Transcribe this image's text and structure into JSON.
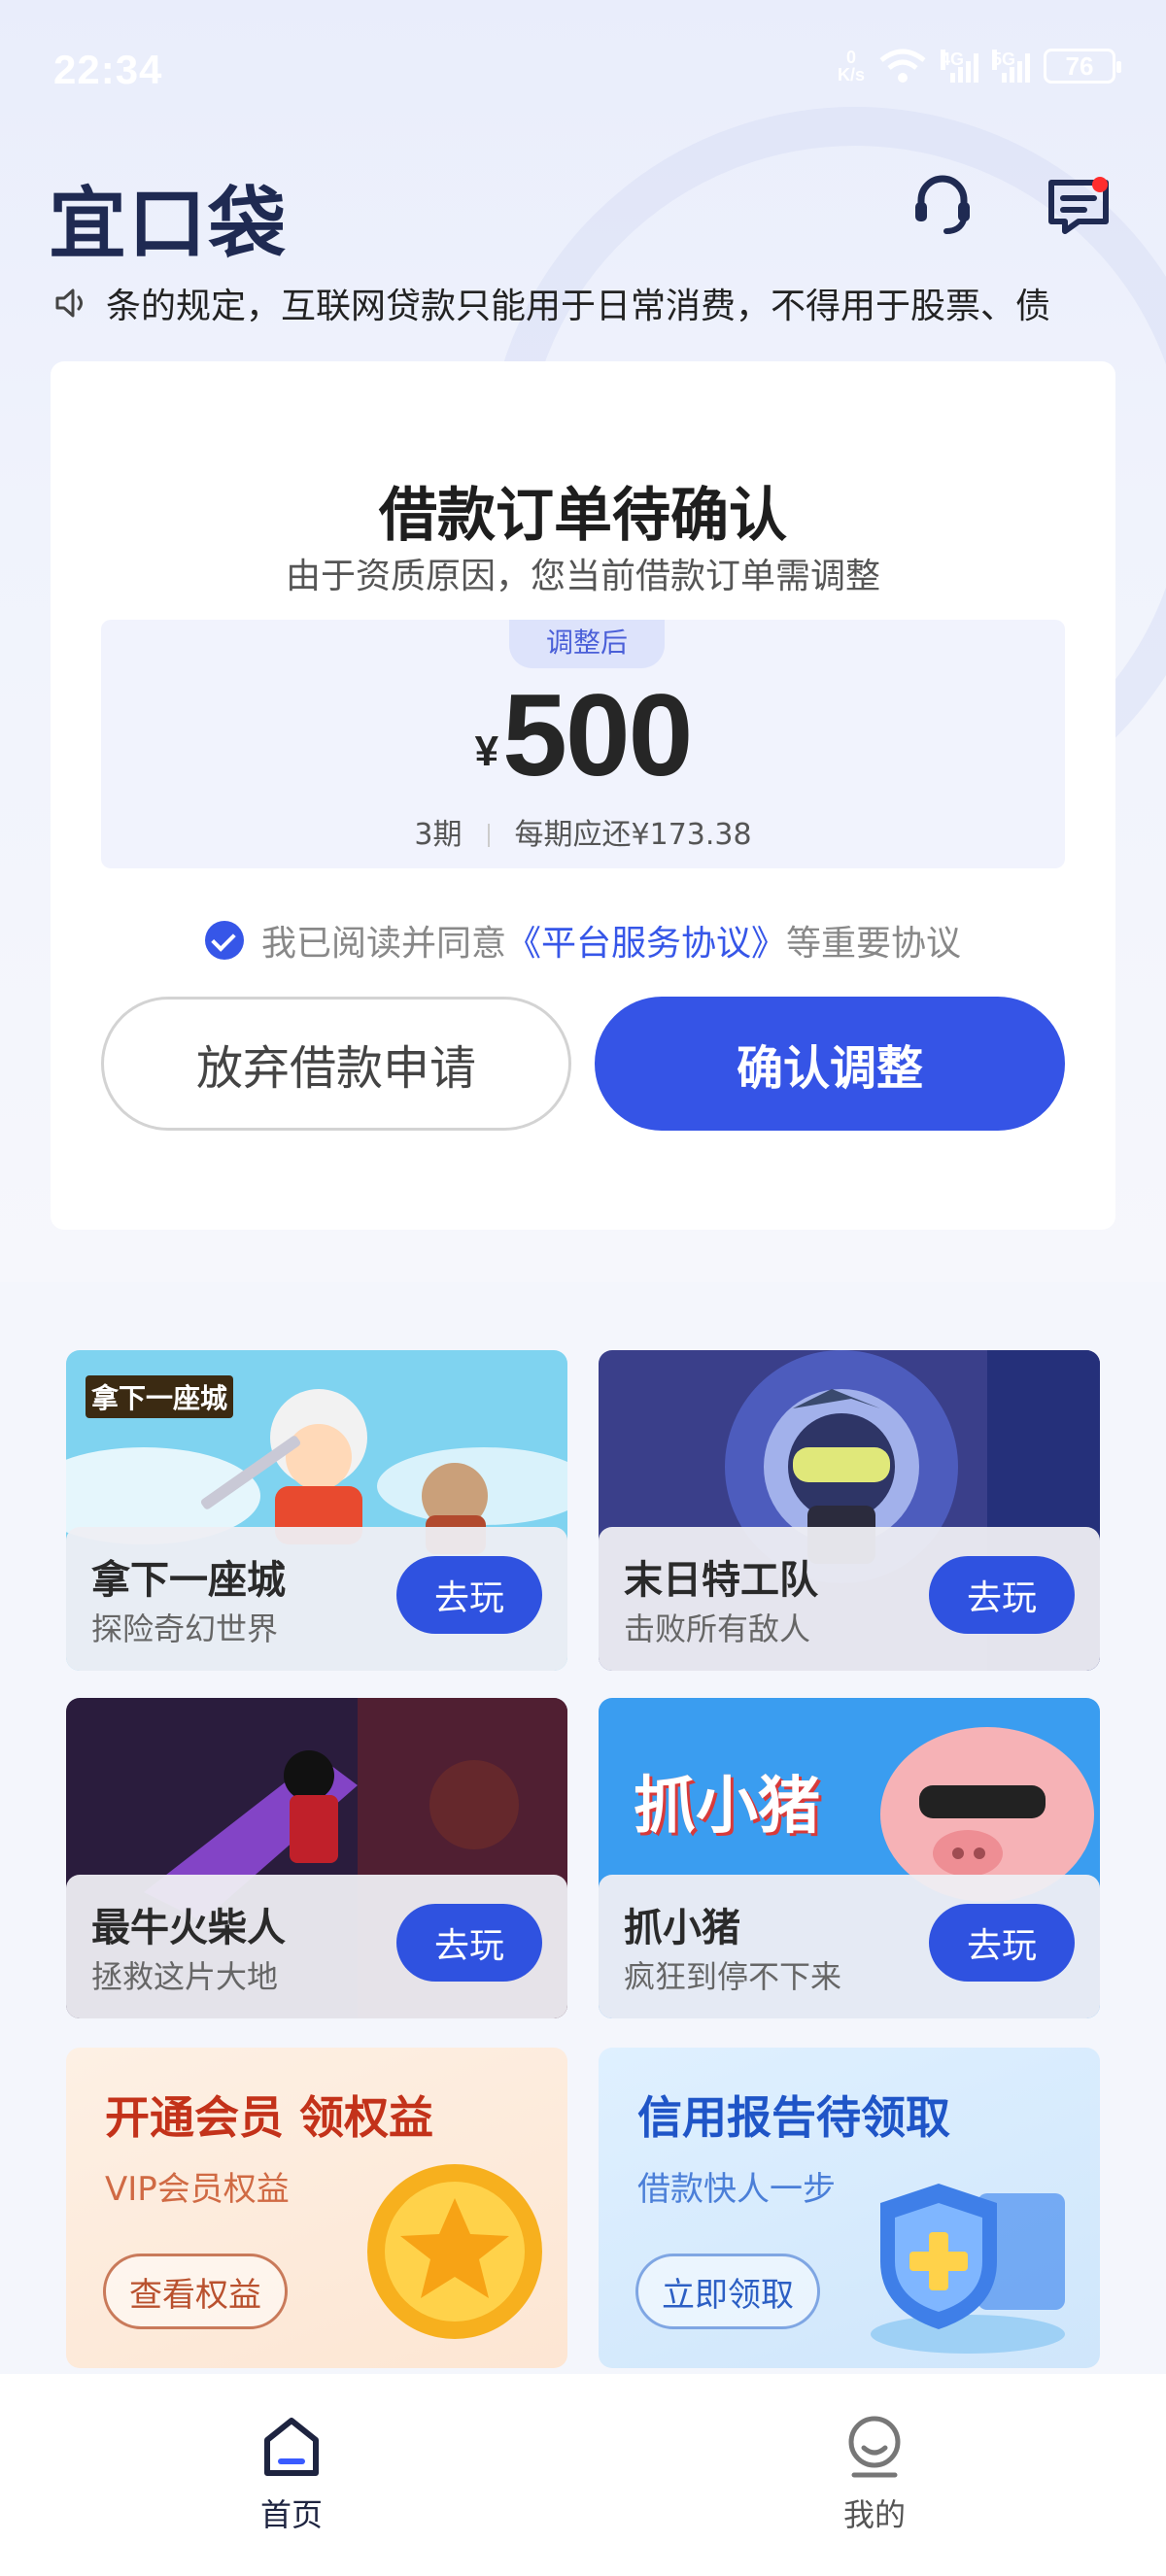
{
  "status_bar": {
    "time": "22:34",
    "net_speed_value": "0",
    "net_speed_unit": "K/s",
    "sig1": "4G",
    "sig2": "5G",
    "battery": "76"
  },
  "header": {
    "logo": "宜口袋"
  },
  "notice": {
    "text": "条的规定，互联网贷款只能用于日常消费，不得用于股票、债"
  },
  "card": {
    "title": "借款订单待确认",
    "subtitle": "由于资质原因，您当前借款订单需调整",
    "adjusted_tag": "调整后",
    "currency": "¥",
    "amount": "500",
    "periods": "3期",
    "per_period": "每期应还¥173.38",
    "agree_prefix": "我已阅读并同意",
    "agree_link": "《平台服务协议》",
    "agree_suffix": "等重要协议",
    "abandon_label": "放弃借款申请",
    "confirm_label": "确认调整"
  },
  "games": [
    {
      "name": "拿下一座城",
      "desc": "探险奇幻世界",
      "play": "去玩",
      "banner_text": "拿下一座城"
    },
    {
      "name": "末日特工队",
      "desc": "击败所有敌人",
      "play": "去玩"
    },
    {
      "name": "最牛火柴人",
      "desc": "拯救这片大地",
      "play": "去玩"
    },
    {
      "name": "抓小猪",
      "desc": "疯狂到停不下来",
      "play": "去玩",
      "banner_text": "抓小猪"
    }
  ],
  "promos": [
    {
      "title": "开通会员 领权益",
      "subtitle": "VIP会员权益",
      "button": "查看权益",
      "color": "#c3321a"
    },
    {
      "title": "信用报告待领取",
      "subtitle": "借款快人一步",
      "button": "立即领取",
      "color": "#1f55c7"
    }
  ],
  "bottom_nav": {
    "home": "首页",
    "mine": "我的"
  },
  "colors": {
    "accent": "#3554e6",
    "logo": "#1f2a52"
  }
}
